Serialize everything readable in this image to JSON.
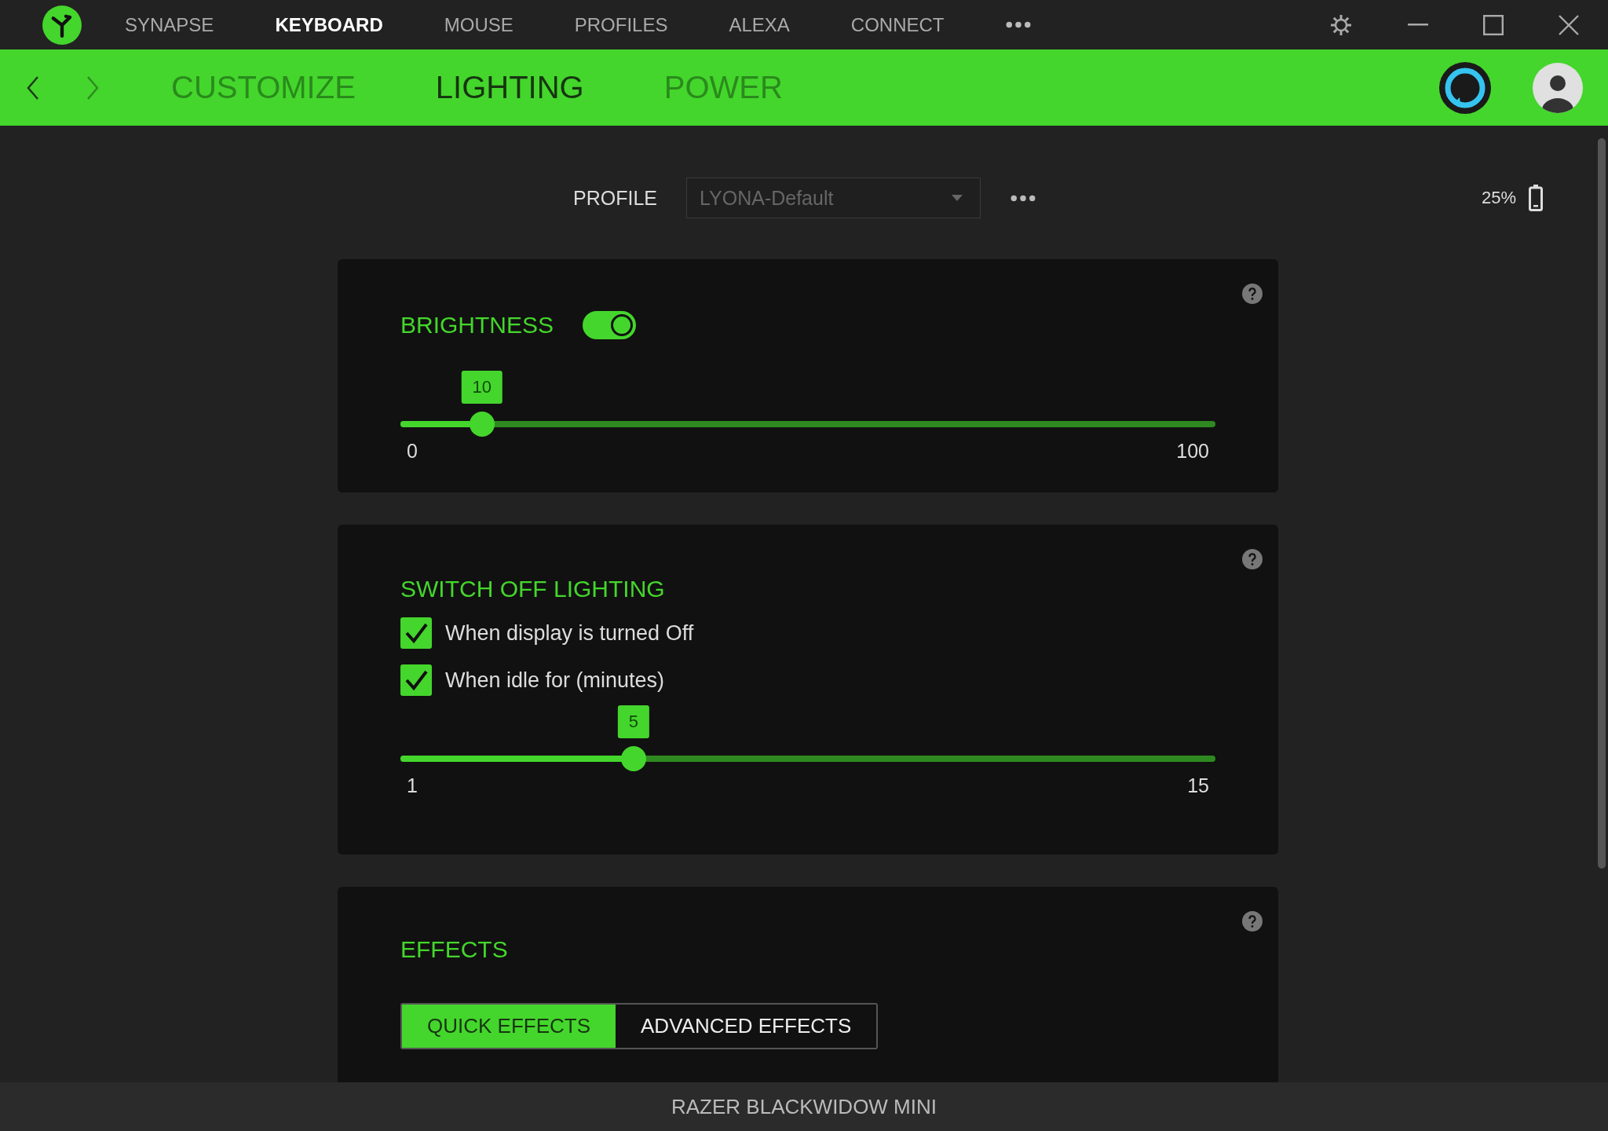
{
  "nav_tabs": [
    {
      "label": "SYNAPSE",
      "selected": false
    },
    {
      "label": "KEYBOARD",
      "selected": true
    },
    {
      "label": "MOUSE",
      "selected": false
    },
    {
      "label": "PROFILES",
      "selected": false
    },
    {
      "label": "ALEXA",
      "selected": false
    },
    {
      "label": "CONNECT",
      "selected": false
    }
  ],
  "sub_tabs": [
    {
      "label": "CUSTOMIZE",
      "selected": false
    },
    {
      "label": "LIGHTING",
      "selected": true
    },
    {
      "label": "POWER",
      "selected": false
    }
  ],
  "profile": {
    "label": "PROFILE",
    "value": "LYONA-Default"
  },
  "battery": {
    "reading": "25%"
  },
  "brightness": {
    "title": "BRIGHTNESS",
    "on": true,
    "slider": {
      "value": "10",
      "level": 0.1,
      "min": "0",
      "max": "100"
    }
  },
  "switch_off": {
    "title": "SWITCH OFF LIGHTING",
    "options": [
      {
        "label": "When display is turned Off",
        "checked": true
      },
      {
        "label": "When idle for (minutes)",
        "checked": true
      }
    ],
    "slider": {
      "value": "5",
      "level": 0.286,
      "min": "1",
      "max": "15"
    }
  },
  "effects": {
    "title": "EFFECTS",
    "tabs": [
      {
        "label": "QUICK EFFECTS",
        "selected": true
      },
      {
        "label": "ADVANCED EFFECTS",
        "selected": false
      }
    ]
  },
  "status_bar": {
    "device": "RAZER BLACKWIDOW MINI"
  }
}
